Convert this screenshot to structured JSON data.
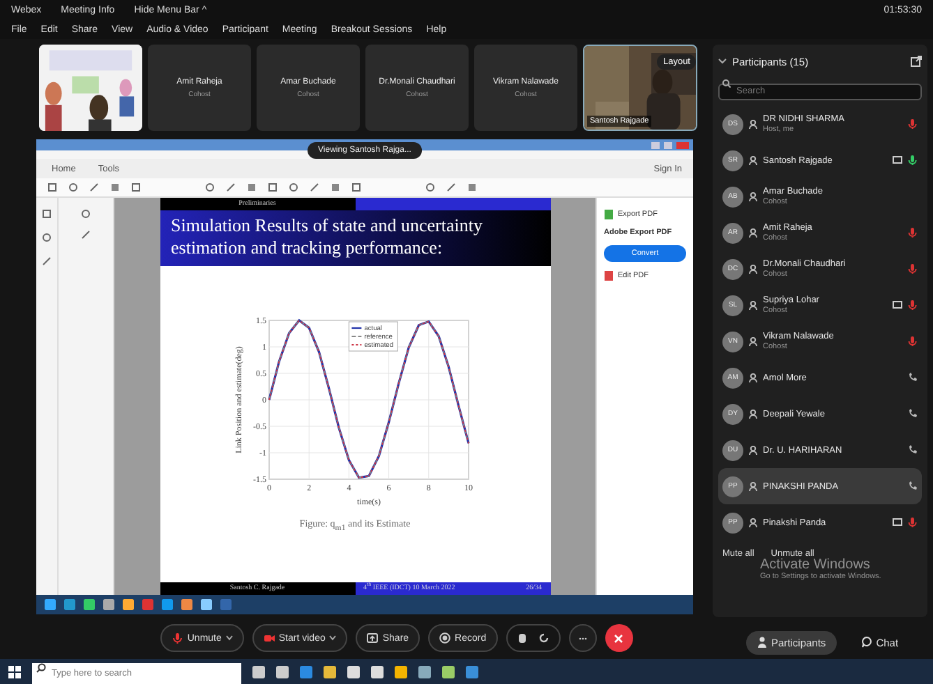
{
  "menu_bar": {
    "items": [
      "Webex",
      "Meeting Info",
      "Hide Menu Bar ^"
    ],
    "clock": "01:53:30"
  },
  "menus": [
    "File",
    "Edit",
    "Share",
    "View",
    "Audio & Video",
    "Participant",
    "Meeting",
    "Breakout Sessions",
    "Help"
  ],
  "thumbnails": [
    {
      "kind": "picture"
    },
    {
      "kind": "name",
      "name": "Amit Raheja",
      "role": "Cohost"
    },
    {
      "kind": "name",
      "name": "Amar Buchade",
      "role": "Cohost"
    },
    {
      "kind": "name",
      "name": "Dr.Monali Chaudhari",
      "role": "Cohost"
    },
    {
      "kind": "name",
      "name": "Vikram Nalawade",
      "role": "Cohost"
    },
    {
      "kind": "video",
      "name": "Santosh Rajgade",
      "button": "Layout"
    }
  ],
  "shared_screen": {
    "viewing_badge": "Viewing Santosh Rajga...",
    "tabs": [
      {
        "label": "Home",
        "selected": false
      },
      {
        "label": "Tools",
        "selected": false
      }
    ],
    "sign_in": "Sign In",
    "right_pane": {
      "export": "Export PDF",
      "heading": "Adobe Export PDF",
      "convert": "Convert",
      "edit": "Edit PDF"
    },
    "slide": {
      "section": "Preliminaries",
      "title": "Simulation Results of state and uncertainty estimation and tracking performance:",
      "chart_data": {
        "type": "line",
        "xlabel": "time(s)",
        "ylabel": "Link Position and estimate(deg)",
        "x": [
          0,
          0.5,
          1,
          1.5,
          2,
          2.5,
          3,
          3.5,
          4,
          4.5,
          5,
          5.5,
          6,
          6.5,
          7,
          7.5,
          8,
          8.5,
          9,
          9.5,
          10
        ],
        "series": [
          {
            "name": "actual",
            "color": "#2233aa",
            "line_style": "solid",
            "values": [
              0,
              0.72,
              1.26,
              1.5,
              1.36,
              0.9,
              0.21,
              -0.53,
              -1.14,
              -1.47,
              -1.44,
              -1.06,
              -0.42,
              0.32,
              0.99,
              1.41,
              1.48,
              1.2,
              0.62,
              -0.11,
              -0.82
            ]
          },
          {
            "name": "reference",
            "color": "#888888",
            "line_style": "dashed",
            "values": [
              0,
              0.72,
              1.26,
              1.5,
              1.36,
              0.9,
              0.21,
              -0.53,
              -1.14,
              -1.47,
              -1.44,
              -1.06,
              -0.42,
              0.32,
              0.99,
              1.41,
              1.48,
              1.2,
              0.62,
              -0.11,
              -0.82
            ]
          },
          {
            "name": "estimated",
            "color": "#cc3344",
            "line_style": "dotted",
            "values": [
              0,
              0.72,
              1.26,
              1.5,
              1.36,
              0.9,
              0.21,
              -0.53,
              -1.14,
              -1.47,
              -1.44,
              -1.06,
              -0.42,
              0.32,
              0.99,
              1.41,
              1.48,
              1.2,
              0.62,
              -0.11,
              -0.82
            ]
          }
        ],
        "grid": true,
        "legend": "upper center",
        "xlim": [
          0,
          10
        ],
        "ylim": [
          -1.5,
          1.5
        ],
        "xticks": [
          0,
          2,
          4,
          6,
          8,
          10
        ],
        "yticks": [
          -1.5,
          -1,
          -0.5,
          0,
          0.5,
          1,
          1.5
        ]
      },
      "caption": "Figure: q$_{m1}$ and its Estimate",
      "footer_left": "Santosh C. Rajgade",
      "footer_mid": "4$^{th}$ IEEE (IDCT) 10 March 2022",
      "footer_page": "26/34"
    }
  },
  "controls": [
    {
      "kind": "unmute",
      "label": "Unmute",
      "caret": true
    },
    {
      "kind": "video",
      "label": "Start video",
      "caret": true
    },
    {
      "kind": "share",
      "label": "Share",
      "caret": false
    },
    {
      "kind": "record",
      "label": "Record",
      "caret": false
    },
    {
      "kind": "pair"
    },
    {
      "kind": "more"
    },
    {
      "kind": "leave"
    }
  ],
  "participants_panel": {
    "title": "Participants (15)",
    "search_placeholder": "Search",
    "participants": [
      {
        "initials": "DS",
        "name": "DR NIDHI SHARMA",
        "role": "Host, me",
        "kind": "muted",
        "sharing": false,
        "selected": false
      },
      {
        "initials": "SR",
        "name": "Santosh Rajgade",
        "kind": "talking",
        "sharing": true,
        "selected": false
      },
      {
        "initials": "AB",
        "name": "Amar Buchade",
        "role": "Cohost",
        "kind": "plain",
        "sharing": false,
        "selected": false
      },
      {
        "initials": "AR",
        "name": "Amit Raheja",
        "role": "Cohost",
        "kind": "muted",
        "sharing": false,
        "selected": false
      },
      {
        "initials": "DC",
        "name": "Dr.Monali Chaudhari",
        "role": "Cohost",
        "kind": "muted",
        "sharing": false,
        "selected": false
      },
      {
        "initials": "SL",
        "name": "Supriya Lohar",
        "role": "Cohost",
        "kind": "muted",
        "sharing": true,
        "selected": false
      },
      {
        "initials": "VN",
        "name": "Vikram Nalawade",
        "role": "Cohost",
        "kind": "muted",
        "sharing": false,
        "selected": false
      },
      {
        "initials": "AM",
        "name": "Amol More",
        "kind": "phone",
        "sharing": false,
        "selected": false
      },
      {
        "initials": "DY",
        "name": "Deepali Yewale",
        "kind": "phone",
        "sharing": false,
        "selected": false
      },
      {
        "initials": "DU",
        "name": "Dr. U. HARIHARAN",
        "kind": "phone",
        "sharing": false,
        "selected": false
      },
      {
        "initials": "PP",
        "name": "PINAKSHI PANDA",
        "kind": "phone",
        "sharing": false,
        "selected": true
      },
      {
        "initials": "PP",
        "name": "Pinakshi Panda",
        "kind": "muted",
        "sharing": true,
        "selected": false
      }
    ],
    "mute_all": "Mute all",
    "unmute_all": "Unmute all",
    "notice_title": "Activate Windows",
    "notice_text": "Go to Settings to activate Windows.",
    "tabs": [
      {
        "label": "Participants",
        "selected": true
      },
      {
        "label": "Chat",
        "selected": false
      }
    ]
  },
  "taskbar": {
    "search_placeholder": "Type here to search"
  }
}
